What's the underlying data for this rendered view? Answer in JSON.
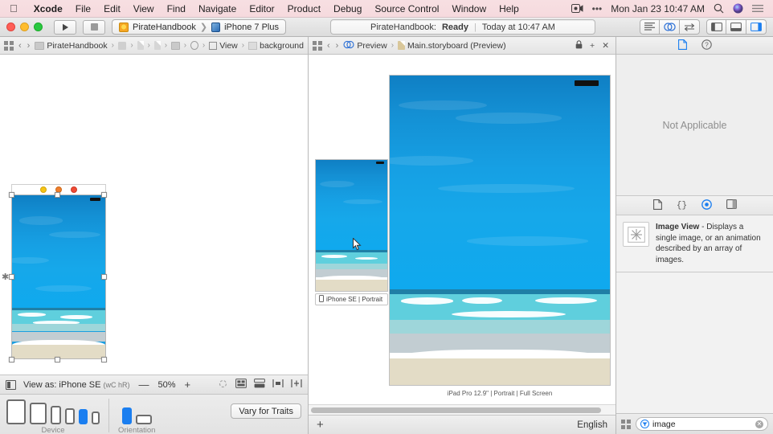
{
  "menubar": {
    "apple_icon": "apple-logo-icon",
    "items": [
      {
        "label": "Xcode",
        "bold": true
      },
      {
        "label": "File",
        "bold": false
      },
      {
        "label": "Edit",
        "bold": false
      },
      {
        "label": "View",
        "bold": false
      },
      {
        "label": "Find",
        "bold": false
      },
      {
        "label": "Navigate",
        "bold": false
      },
      {
        "label": "Editor",
        "bold": false
      },
      {
        "label": "Product",
        "bold": false
      },
      {
        "label": "Debug",
        "bold": false
      },
      {
        "label": "Source Control",
        "bold": false
      },
      {
        "label": "Window",
        "bold": false
      },
      {
        "label": "Help",
        "bold": false
      }
    ],
    "right": {
      "screen_recording_icon": "screen-record-icon",
      "ellipsis": "•••",
      "clock": "Mon Jan 23  10:47 AM",
      "search_icon": "spotlight-search-icon",
      "siri_icon": "siri-icon",
      "control_center_icon": "notification-center-icon"
    },
    "bg": "#f6dcdf"
  },
  "toolbar": {
    "run_label": "▶",
    "stop_label": "■",
    "scheme_project": "PirateHandbook",
    "scheme_sep": "❯",
    "scheme_device": "iPhone 7 Plus",
    "status_project": "PirateHandbook:",
    "status_state": "Ready",
    "status_sep": "|",
    "status_time": "Today at 10:47 AM",
    "editor_modes": [
      "standard-editor-icon",
      "assistant-editor-icon",
      "version-editor-icon"
    ],
    "panel_toggles": [
      "navigator-toggle-icon",
      "debug-area-toggle-icon",
      "utilities-toggle-icon"
    ],
    "active_panel_toggle": 2
  },
  "editor": {
    "jumpbar": {
      "grid_icon": "related-items-icon",
      "back_icon": "‹",
      "forward_icon": "›",
      "crumbs": [
        {
          "icon": "project-icon",
          "label": "PirateHandbook"
        },
        {
          "icon": "folder-icon",
          "label": ""
        },
        {
          "icon": "file-icon",
          "label": ""
        },
        {
          "icon": "file-icon",
          "label": ""
        },
        {
          "icon": "storyboard-icon",
          "label": ""
        },
        {
          "icon": "view-controller-icon",
          "label": ""
        },
        {
          "icon": "view-square-icon",
          "label": "View"
        },
        {
          "icon": "image-view-icon",
          "label": "background"
        }
      ]
    },
    "scene_dock": [
      "view-controller-dock-icon",
      "first-responder-dock-icon",
      "exit-dock-icon"
    ],
    "selected_element": "background",
    "bottom_bar": {
      "device_icon": "view-as-icon",
      "view_as_label": "View as: iPhone SE",
      "traits_label": "(wC hR)",
      "zoom_out": "—",
      "zoom_level": "50%",
      "zoom_in": "+",
      "right_icons": [
        "focus-icon",
        "constraints-icon",
        "align-icon",
        "pin-icon",
        "resolve-icon"
      ]
    },
    "device_bar": {
      "device_caption": "Device",
      "orientation_caption": "Orientation",
      "devices": [
        "ipad-pro-12",
        "ipad",
        "iphone-plus",
        "iphone",
        "iphone-se",
        "iphone-4s"
      ],
      "selected_device_index": 4,
      "orientations": [
        "portrait",
        "landscape"
      ],
      "selected_orientation_index": 0,
      "vary_label": "Vary for Traits"
    }
  },
  "preview": {
    "jumpbar": {
      "grid_icon": "related-items-icon",
      "back_icon": "‹",
      "forward_icon": "›",
      "assistant_icon": "assistant-editor-icon",
      "assistant_label": "Preview",
      "sep": "❯",
      "file_icon": "storyboard-icon",
      "file_label": "Main.storyboard (Preview)",
      "lock_icon": "lock-icon",
      "add_icon": "+",
      "close_icon": "✕"
    },
    "devices": [
      {
        "label": "iPhone SE | Portrait",
        "chip": true
      },
      {
        "label": "iPad Pro 12.9\" | Portrait | Full Screen",
        "chip": false
      }
    ],
    "bottom": {
      "add_label": "+",
      "language": "English"
    }
  },
  "inspector": {
    "tabs": [
      "file-inspector-icon",
      "quick-help-icon"
    ],
    "active_tab": 0,
    "empty_message": "Not Applicable",
    "library_tabs": [
      "file-template-library-icon",
      "code-snippet-library-icon",
      "object-library-icon",
      "media-library-icon"
    ],
    "active_library_tab": 2,
    "item": {
      "icon": "image-view-thumbnail-icon",
      "title": "Image View",
      "dash": " - ",
      "description": "Displays a single image, or an animation described by an array of images."
    },
    "search": {
      "grid_icon": "library-grid-icon",
      "filter_icon": "filter-icon",
      "value": "image",
      "placeholder": "Filter",
      "clear_icon": "clear-icon"
    }
  },
  "colors": {
    "accent": "#1a7ef0",
    "menubar_bg": "#f6dcdf",
    "sky_top": "#0f7fc4",
    "sky_bottom": "#0fa9ee",
    "horizon": "#1f7fa6",
    "sea": "#5fcfdd",
    "sea_pale": "#9ed6da",
    "shallow": "#c2cdd2",
    "foam": "#ffffff",
    "sand": "#e3dcc6"
  }
}
